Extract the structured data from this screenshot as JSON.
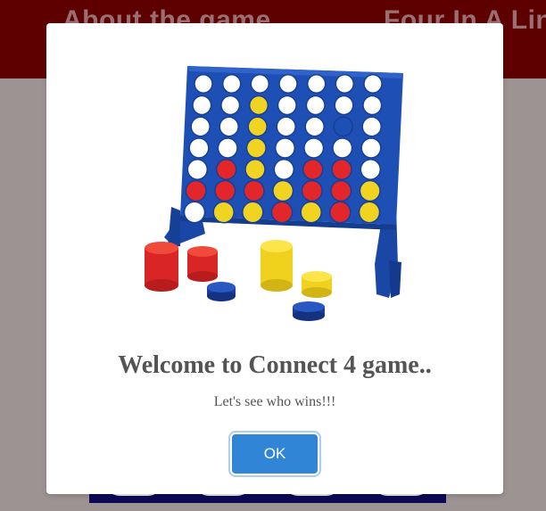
{
  "nav": {
    "about_label": "About the game",
    "title_label": "Four In A Line"
  },
  "modal": {
    "title": "Welcome to Connect 4 game..",
    "text": "Let's see who wins!!!",
    "ok_label": "OK"
  },
  "colors": {
    "header_bg": "#5e0000",
    "overlay_bg": "#9c9393",
    "ok_button": "#3085d6",
    "board_blue": "#1e4fb4",
    "disc_red": "#e3262a",
    "disc_yellow": "#f1d321"
  },
  "illustration": {
    "icon": "connect-four-board-icon",
    "columns": 7,
    "rows": 6,
    "grid": [
      "EEEEEEE",
      "EEYEEEE",
      "EEYEEBE",
      "EEYEEEE",
      "ERYERRE",
      "RRRYRRY",
      "EYYRYRY"
    ]
  }
}
